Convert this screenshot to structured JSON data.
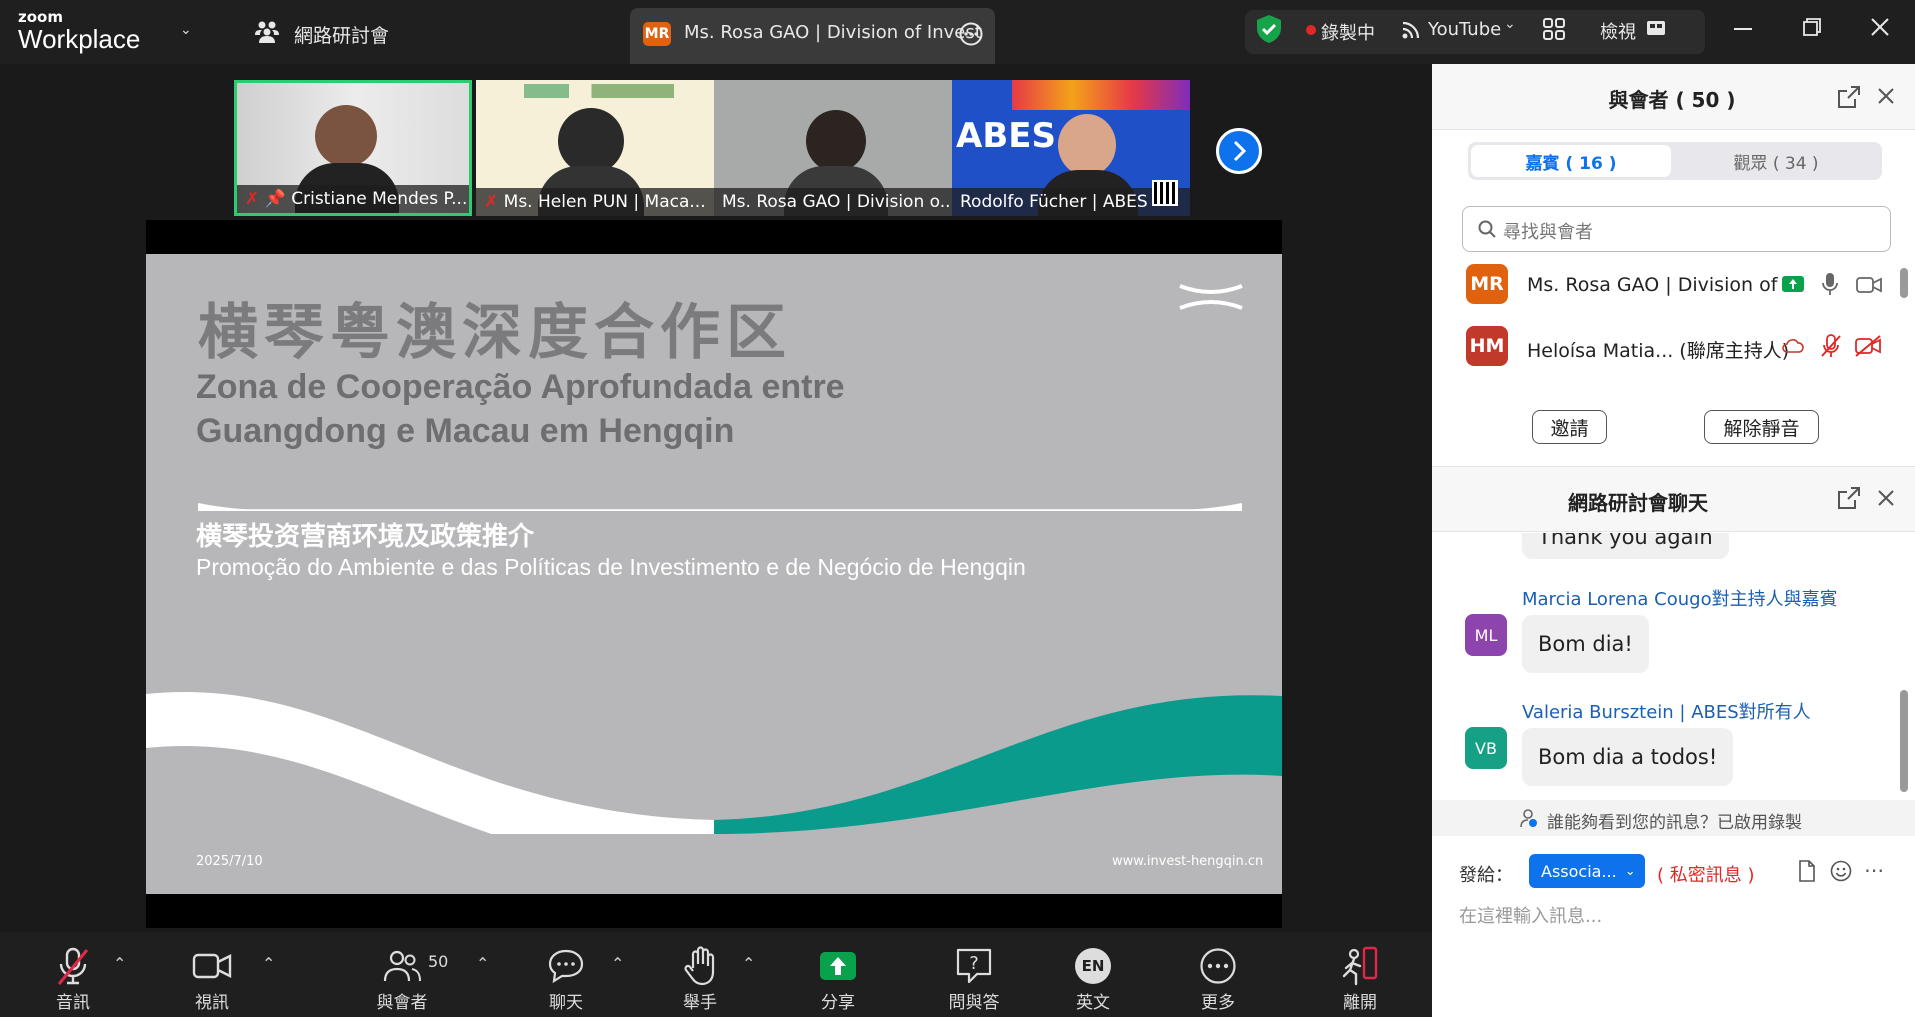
{
  "app": {
    "logo_small": "zoom",
    "logo_big": "Workplace"
  },
  "topbar": {
    "webinar_label": "網路研討會",
    "active_tab": {
      "initials": "MR",
      "title": "Ms. Rosa GAO | Division of Invest"
    },
    "recording": "錄製中",
    "youtube": "YouTube",
    "view": "檢視",
    "icons": [
      "shield-check-icon",
      "record-dot-icon",
      "live-stream-icon",
      "gallery-icon",
      "view-grid-icon",
      "minimize-icon",
      "restore-icon",
      "close-icon"
    ]
  },
  "thumbnails": [
    {
      "name": "Cristiane Mendes P...",
      "bg": "#e6e6e6",
      "active": true
    },
    {
      "name": "Ms. Helen PUN | Maca...",
      "bg": "#f6f0d8"
    },
    {
      "name": "Ms. Rosa GAO | Division o...",
      "bg": "#9a9e9c"
    },
    {
      "name": "Rodolfo Fücher | ABES",
      "bg": "#2050c8",
      "brand": "ABES"
    }
  ],
  "slide": {
    "title_cn": "横琴粤澳深度合作区",
    "title_pt_1": "Zona de Cooperação Aprofundada entre",
    "title_pt_2": "Guangdong e Macau em Hengqin",
    "subtitle_cn": "横琴投资营商环境及政策推介",
    "subtitle_pt": "Promoção do Ambiente e das Políticas de Investimento e de Negócio de Hengqin",
    "date": "2025/7/10",
    "url": "www.invest-hengqin.cn",
    "accent": "#0a9b8c"
  },
  "participants": {
    "title": "與會者 ( 50 )",
    "tabs": {
      "panelists": "嘉賓 ( 16 )",
      "attendees": "觀眾 ( 34 )"
    },
    "search_placeholder": "尋找與會者",
    "list": [
      {
        "initials": "MR",
        "color": "#e0620e",
        "name": "Ms. Rosa GAO | Division of ..."
      },
      {
        "initials": "HM",
        "color": "#c0392b",
        "name": "Heloísa Matia... (聯席主持人)"
      }
    ],
    "invite": "邀請",
    "unmute": "解除靜音"
  },
  "chat": {
    "title": "網路研討會聊天",
    "partial": "Thank you again",
    "messages": [
      {
        "initials": "ML",
        "color": "#8e44ad",
        "sender": "Marcia Lorena Cougo",
        "to": "對主持人與嘉賓",
        "text": "Bom dia!"
      },
      {
        "initials": "VB",
        "color": "#16a085",
        "sender": "Valeria Bursztein | ABES",
        "to": "對所有人",
        "text": "Bom dia a todos!"
      }
    ],
    "notice": "誰能夠看到您的訊息？已啟用錄製",
    "send_to_label": "發給：",
    "send_to_value": "Associa...",
    "private": "( 私密訊息 )",
    "input_placeholder": "在這裡輸入訊息..."
  },
  "toolbar": {
    "audio": "音訊",
    "video": "視訊",
    "participants": "與會者",
    "participants_count": "50",
    "chat": "聊天",
    "raise_hand": "舉手",
    "share": "分享",
    "qa": "問與答",
    "language": "英文",
    "language_badge": "EN",
    "more": "更多",
    "leave": "離開"
  },
  "colors": {
    "blue": "#0e72ed",
    "green": "#0aa14c",
    "red": "#e02828"
  }
}
